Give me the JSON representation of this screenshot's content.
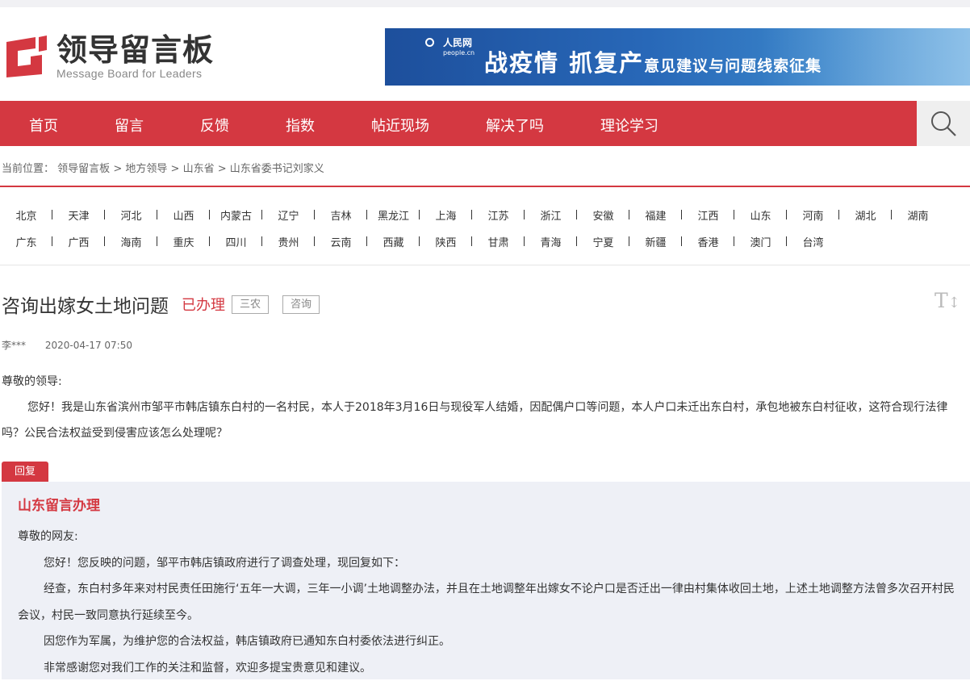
{
  "header": {
    "logo_cn": "领导留言板",
    "logo_en": "Message Board for Leaders",
    "banner_brand": "人民网",
    "banner_brand_sub": "people.cn",
    "banner_title": "战疫情  抓复产",
    "banner_subtitle": "意见建议与问题线索征集"
  },
  "nav": {
    "items": [
      "首页",
      "留言",
      "反馈",
      "指数",
      "帖近现场",
      "解决了吗",
      "理论学习"
    ]
  },
  "breadcrumb": {
    "label": "当前位置：",
    "items": [
      "领导留言板",
      "地方领导",
      "山东省",
      "山东省委书记刘家义"
    ],
    "separator": ">"
  },
  "provinces": {
    "row1": [
      "北京",
      "天津",
      "河北",
      "山西",
      "内蒙古",
      "辽宁",
      "吉林",
      "黑龙江",
      "上海",
      "江苏",
      "浙江",
      "安徽",
      "福建",
      "江西",
      "山东",
      "河南",
      "湖北",
      "湖南"
    ],
    "row2": [
      "广东",
      "广西",
      "海南",
      "重庆",
      "四川",
      "贵州",
      "云南",
      "西藏",
      "陕西",
      "甘肃",
      "青海",
      "宁夏",
      "新疆",
      "香港",
      "澳门",
      "台湾"
    ]
  },
  "post": {
    "title": "咨询出嫁女土地问题",
    "status": "已办理",
    "tags": [
      "三农",
      "咨询"
    ],
    "author": "李***",
    "date": "2020-04-17 07:50",
    "greeting": "尊敬的领导:",
    "body": "您好！我是山东省滨州市邹平市韩店镇东白村的一名村民，本人于2018年3月16日与现役军人结婚，因配偶户口等问题，本人户口未迁出东白村，承包地被东白村征收，这符合现行法律吗？公民合法权益受到侵害应该怎么处理呢？"
  },
  "reply": {
    "tab_label": "回复",
    "org": "山东留言办理",
    "greeting": "尊敬的网友:",
    "paragraphs": [
      "您好！您反映的问题，邹平市韩店镇政府进行了调查处理，现回复如下：",
      "经查，东白村多年来对村民责任田施行‘五年一大调，三年一小调’土地调整办法，并且在土地调整年出嫁女不论户口是否迁出一律由村集体收回土地，上述土地调整方法曾多次召开村民会议，村民一致同意执行延续至今。",
      "因您作为军属，为维护您的合法权益，韩店镇政府已通知东白村委依法进行纠正。",
      "非常感谢您对我们工作的关注和监督，欢迎多提宝贵意见和建议。"
    ]
  },
  "colors": {
    "brand_red": "#d43841",
    "reply_bg": "#eef0f6",
    "banner_blue": "#1d4f9c"
  },
  "icons": {
    "search": "search-icon",
    "font_size": "font-size-toggle-icon"
  }
}
